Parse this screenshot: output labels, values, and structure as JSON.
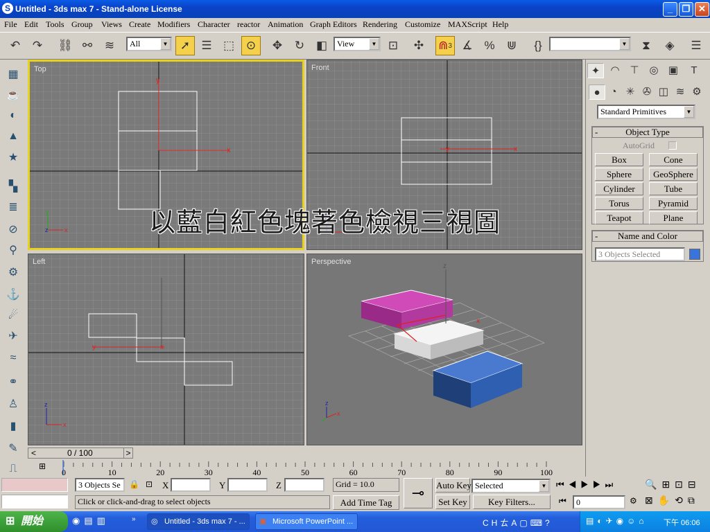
{
  "window": {
    "title": "Untitled - 3ds max 7  - Stand-alone License",
    "app_icon": "3dsmax-icon",
    "minimize": "minimize-icon",
    "maximize": "restore-icon",
    "close": "close-icon"
  },
  "menu": [
    "File",
    "Edit",
    "Tools",
    "Group",
    "Views",
    "Create",
    "Modifiers",
    "Character",
    "reactor",
    "Animation",
    "Graph Editors",
    "Rendering",
    "Customize",
    "MAXScript",
    "Help"
  ],
  "toolbar": {
    "selection_filter": "All",
    "ref_coord": "View",
    "snap_angle_label": "3",
    "named_selection": ""
  },
  "viewports": {
    "top": {
      "label": "Top"
    },
    "front": {
      "label": "Front"
    },
    "left": {
      "label": "Left"
    },
    "perspective": {
      "label": "Perspective"
    }
  },
  "overlay_caption": "以藍白紅色塊著色檢視三視圖",
  "command_panel": {
    "category": "Standard Primitives",
    "object_type_title": "Object Type",
    "autogrid_label": "AutoGrid",
    "buttons": [
      "Box",
      "Cone",
      "Sphere",
      "GeoSphere",
      "Cylinder",
      "Tube",
      "Torus",
      "Pyramid",
      "Teapot",
      "Plane"
    ],
    "name_color_title": "Name and Color",
    "name_field": "3 Objects Selected",
    "color_swatch": "#3a73d9"
  },
  "time_slider": {
    "frame_display": "0 / 100",
    "prev": "<",
    "next": ">"
  },
  "track_ticks": [
    "0",
    "10",
    "20",
    "30",
    "40",
    "50",
    "60",
    "70",
    "80",
    "90",
    "100"
  ],
  "status": {
    "selection_info": "3 Objects Se",
    "x_label": "X",
    "y_label": "Y",
    "z_label": "Z",
    "x_value": "",
    "y_value": "",
    "z_value": "",
    "grid": "Grid = 10.0",
    "prompt": "Click or click-and-drag to select objects",
    "add_time_tag": "Add Time Tag",
    "auto_key": "Auto Key",
    "set_key": "Set Key",
    "key_mode": "Selected",
    "key_filters": "Key Filters...",
    "current_frame": "0"
  },
  "taskbar": {
    "start": "開始",
    "tasks": [
      "Untitled - 3ds max 7 - ...",
      "Microsoft PowerPoint ..."
    ],
    "tray_lang": "CH",
    "time": "下午 06:06"
  },
  "scene_colors": {
    "purple_box": "#b23a9e",
    "white_box": "#e8e8e8",
    "blue_box": "#2f5fb0",
    "active_border": "#e8d21e"
  }
}
